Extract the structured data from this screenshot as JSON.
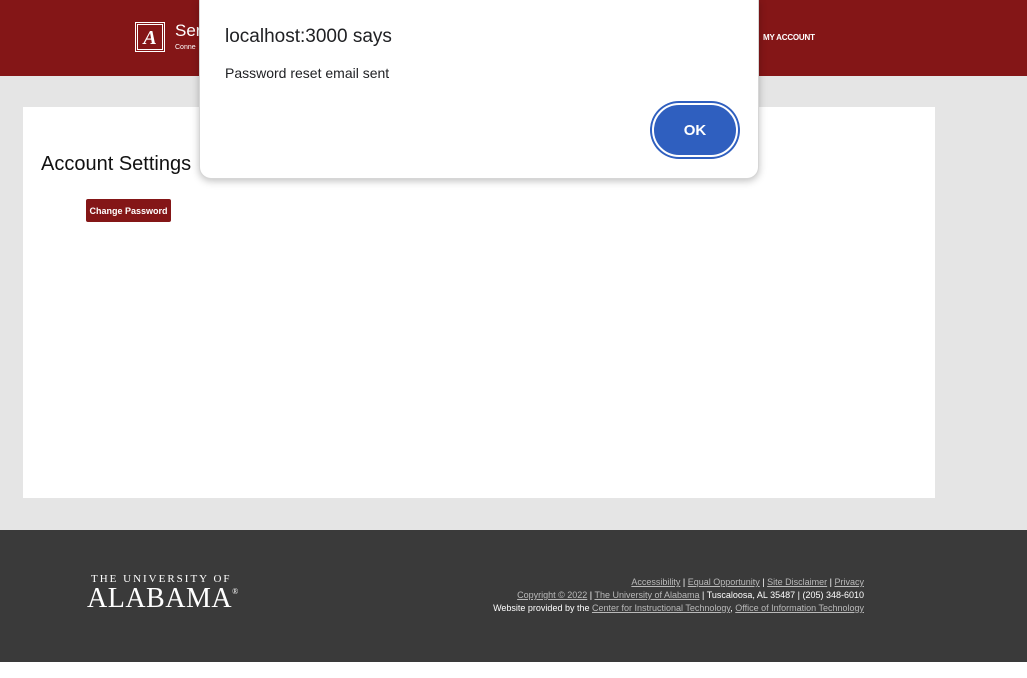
{
  "header": {
    "logo_letter": "A",
    "site_title": "Ser",
    "site_subtitle": "Conne",
    "nav_account": "MY ACCOUNT"
  },
  "main": {
    "title": "Account Settings",
    "change_password_label": "Change Password"
  },
  "dialog": {
    "title": "localhost:3000 says",
    "message": "Password reset email sent",
    "ok_label": "OK"
  },
  "footer": {
    "wordmark_top": "THE UNIVERSITY OF",
    "wordmark_main": "ALABAMA",
    "wordmark_reg": "®",
    "links_row1": [
      "Accessibility",
      "Equal Opportunity",
      "Site Disclaimer",
      "Privacy"
    ],
    "copyright_link": "Copyright © 2022",
    "university_link": "The University of Alabama",
    "address_text": "Tuscaloosa, AL 35487 | (205) 348-6010",
    "provided_by": "Website provided by the",
    "cit_link": "Center for Instructional Technology",
    "oit_link": "Office of Information Technology"
  },
  "colors": {
    "crimson": "#841617",
    "footer_bg": "#3a3a3a",
    "main_bg": "#e5e5e5",
    "dialog_button": "#2f5fbf"
  },
  "icons": {
    "logo": "script-a-logo-icon"
  }
}
